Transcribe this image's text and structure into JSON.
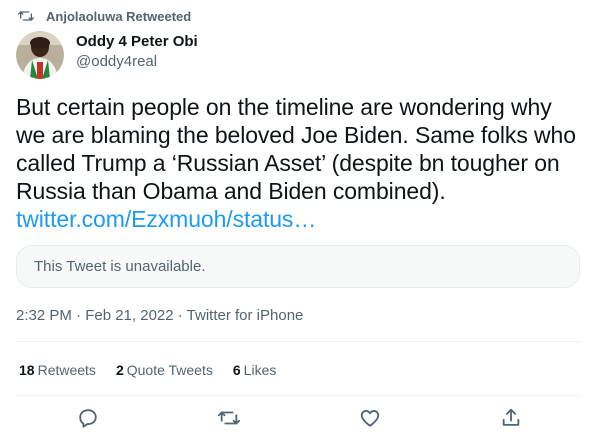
{
  "retweet_context": {
    "text": "Anjolaoluwa Retweeted",
    "icon": "retweet-icon"
  },
  "author": {
    "display_name": "Oddy 4 Peter Obi",
    "handle": "@oddy4real"
  },
  "tweet": {
    "text": "But certain people on the timeline are wondering why we are blaming the beloved Joe Biden. Same folks who called Trump a ‘Russian Asset’ (despite bn tougher on Russia than Obama and Biden combined).",
    "link": "twitter.com/Ezxmuoh/status…"
  },
  "quoted_tweet": {
    "text": "This Tweet is unavailable."
  },
  "meta": {
    "timestamp": "2:32 PM · Feb 21, 2022 · Twitter for iPhone"
  },
  "stats": {
    "retweets_count": "18",
    "retweets_label": "Retweets",
    "quote_tweets_count": "2",
    "quote_tweets_label": "Quote Tweets",
    "likes_count": "6",
    "likes_label": "Likes"
  },
  "actions": [
    "reply-icon",
    "retweet-icon",
    "like-icon",
    "share-icon"
  ],
  "colors": {
    "link": "#1d9bf0",
    "secondary_text": "#536471",
    "primary_text": "#0f1419"
  }
}
